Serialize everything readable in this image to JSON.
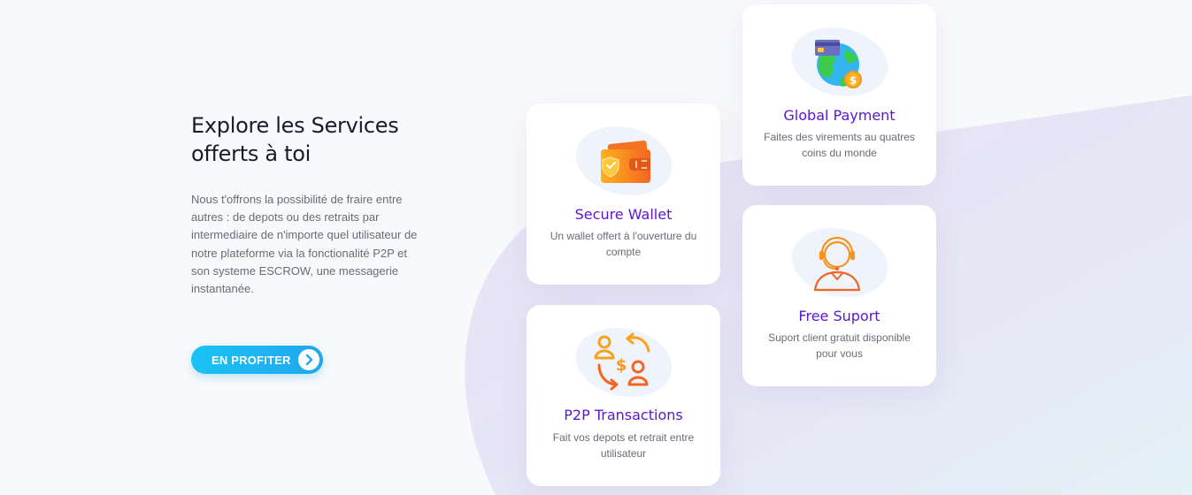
{
  "intro": {
    "title_line1": "Explore les Services",
    "title_line2": "offerts à toi",
    "description": "Nous t'offrons la possibilité de fraire entre autres : de depots ou des retraits par intermediaire de n'importe quel utilisateur de notre plateforme via la fonctionalité P2P et son systeme ESCROW, une messagerie instantanée."
  },
  "cta": {
    "label": "EN PROFITER",
    "icon": "chevron-right-icon"
  },
  "cards": {
    "secure_wallet": {
      "title": "Secure Wallet",
      "description": "Un wallet offert à l'ouverture du compte",
      "icon": "wallet-icon"
    },
    "p2p": {
      "title": "P2P Transactions",
      "description": "Fait vos depots et retrait entre utilisateur",
      "icon": "p2p-exchange-icon"
    },
    "global_payment": {
      "title": "Global Payment",
      "description": "Faites des virements au quatres coins du monde",
      "icon": "globe-payment-icon"
    },
    "support": {
      "title": "Free Suport",
      "description": "Suport client gratuit disponible pour vous",
      "icon": "support-agent-icon"
    }
  },
  "colors": {
    "accent_purple": "#5b14d6",
    "cta_blue": "#21a7ee",
    "illustration_orange": "#f7941d"
  }
}
